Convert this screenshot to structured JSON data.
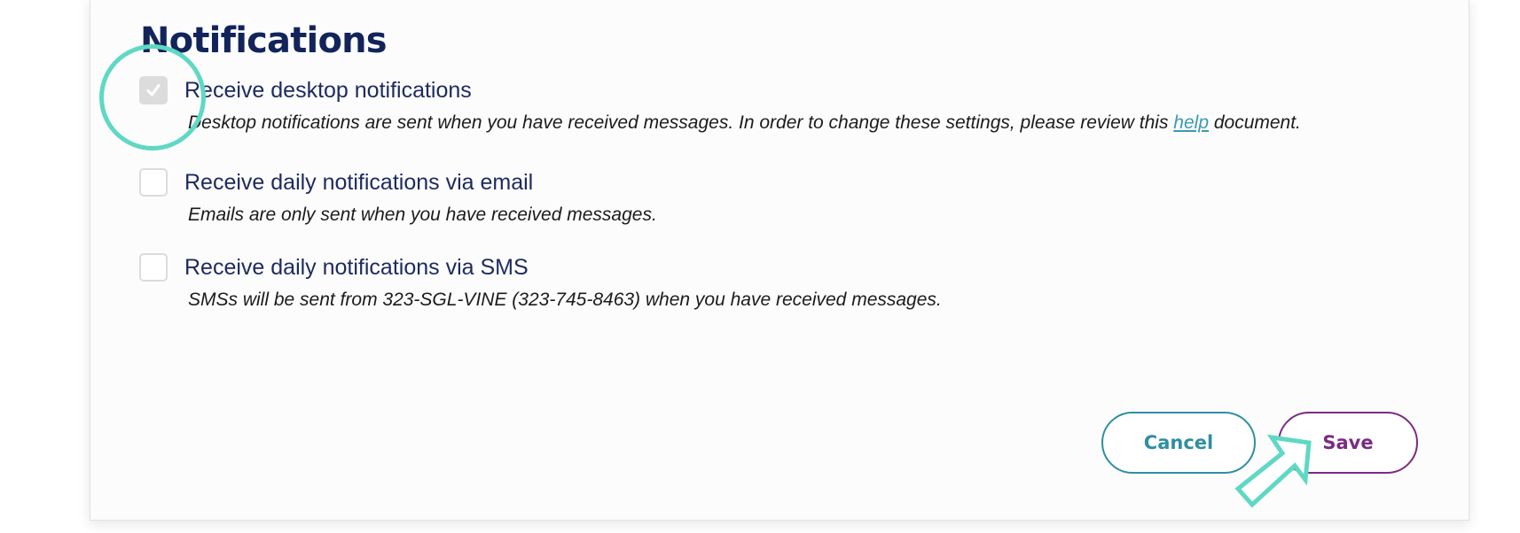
{
  "section": {
    "title": "Notifications"
  },
  "options": [
    {
      "label": "Receive desktop notifications",
      "checked": true,
      "disabled": true,
      "description_before": "Desktop notifications are sent when you have received messages. In order to change these settings, please review this ",
      "description_link": "help",
      "description_after": " document."
    },
    {
      "label": "Receive daily notifications via email",
      "checked": false,
      "description": "Emails are only sent when you have received messages."
    },
    {
      "label": "Receive daily notifications via SMS",
      "checked": false,
      "description": "SMSs will be sent from 323-SGL-VINE (323-745-8463) when you have received messages."
    }
  ],
  "actions": {
    "cancel_label": "Cancel",
    "save_label": "Save"
  },
  "colors": {
    "heading": "#12245a",
    "label": "#1d2a5e",
    "link": "#3a9ab3",
    "cancel": "#2f8fa0",
    "save": "#7b2b82",
    "annotation": "#5fd8c4",
    "checkbox_disabled": "#dcdcdc"
  }
}
